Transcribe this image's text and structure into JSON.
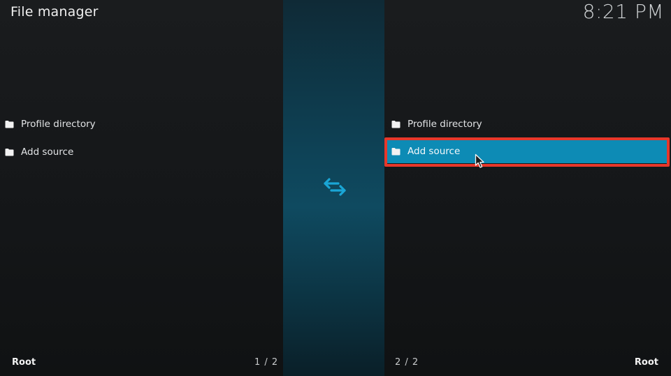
{
  "header": {
    "title": "File manager",
    "clock": "8:21 PM"
  },
  "left_pane": {
    "items": [
      {
        "label": "Profile directory",
        "icon": "folder-icon"
      },
      {
        "label": "Add source",
        "icon": "folder-icon"
      }
    ],
    "footer_label": "Root",
    "footer_count": "1 / 2"
  },
  "right_pane": {
    "items": [
      {
        "label": "Profile directory",
        "icon": "folder-icon"
      },
      {
        "label": "Add source",
        "icon": "folder-icon",
        "selected": true
      }
    ],
    "footer_label": "Root",
    "footer_count": "2 / 2"
  },
  "middle": {
    "icon": "swap-arrows-icon"
  },
  "colors": {
    "selection": "#0d8bb5",
    "highlight_border": "#e8372a",
    "accent": "#1aa6d6"
  }
}
